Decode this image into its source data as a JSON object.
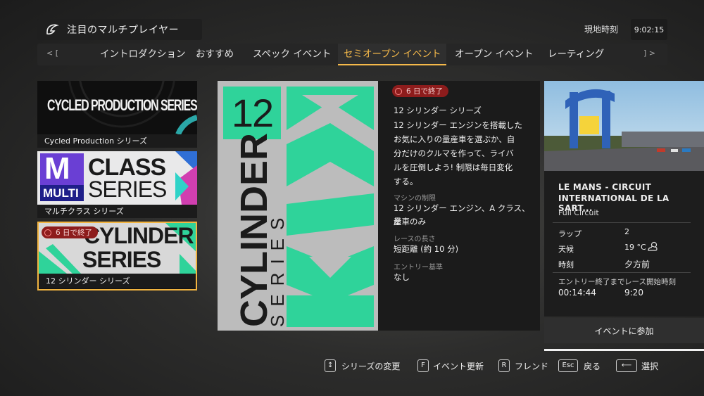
{
  "header": {
    "title": "注目のマルチプレイヤー",
    "clock_label": "現地時刻",
    "clock_value": "9:02:15"
  },
  "tabs": {
    "prev": "< [",
    "next": "] >",
    "items": [
      "イントロダクション",
      "おすすめ",
      "スペック イベント",
      "セミオープン イベント",
      "オープン イベント",
      "レーティング"
    ],
    "active_index": 3
  },
  "series_cards": [
    {
      "art_text": "CYCLED PRODUCTION SERIES",
      "label": "Cycled Production シリーズ"
    },
    {
      "art_text_1": "CLASS",
      "art_text_2": "SERIES",
      "art_badge_letter": "M",
      "art_badge_word": "MULTI",
      "label": "マルチクラス シリーズ"
    },
    {
      "art_text_1": "CYLINDER",
      "art_text_2": "SERIES",
      "badge": "6 日で終了",
      "label": "12 シリンダー シリーズ"
    }
  ],
  "hero": {
    "number": "12",
    "word_1": "CYLINDER",
    "word_2": "SERIES"
  },
  "details": {
    "badge": "6 日で終了",
    "name": "12 シリンダー シリーズ",
    "description_lines": [
      "12 シリンダー エンジンを搭載した",
      "お気に入りの量産車を選ぶか、自",
      "分だけのクルマを作って、ライバ",
      "ルを圧倒しよう! 制限は毎日変化",
      "する。"
    ],
    "restriction_label": "マシンの制限",
    "restriction_lines": [
      "12 シリンダー エンジン、A クラス、量",
      "産車のみ"
    ],
    "length_label": "レースの長さ",
    "length_value": "短距離 (約 10 分)",
    "entry_label": "エントリー基準",
    "entry_value": "なし"
  },
  "track": {
    "name_line1": "LE MANS - CIRCUIT",
    "name_line2": "INTERNATIONAL DE LA SART...",
    "layout": "Full Circuit",
    "laps_label": "ラップ",
    "laps_value": "2",
    "weather_label": "天候",
    "weather_value": "19 °C",
    "time_label": "時刻",
    "time_value": "夕方前",
    "entry_end_label": "エントリー終了まで",
    "entry_end_value": "00:14:44",
    "race_start_label": "レース開始時刻",
    "race_start_value": "9:20",
    "join_label": "イベントに参加"
  },
  "footer": [
    {
      "key": "↕",
      "label": "シリーズの変更"
    },
    {
      "key": "F",
      "label": "イベント更新"
    },
    {
      "key": "R",
      "label": "フレンド"
    },
    {
      "key": "Esc",
      "label": "戻る"
    },
    {
      "key": "⟵",
      "label": "選択"
    }
  ],
  "colors": {
    "accent": "#f5b94a",
    "green": "#2fd39a",
    "timer_red": "#8d1c1c"
  }
}
